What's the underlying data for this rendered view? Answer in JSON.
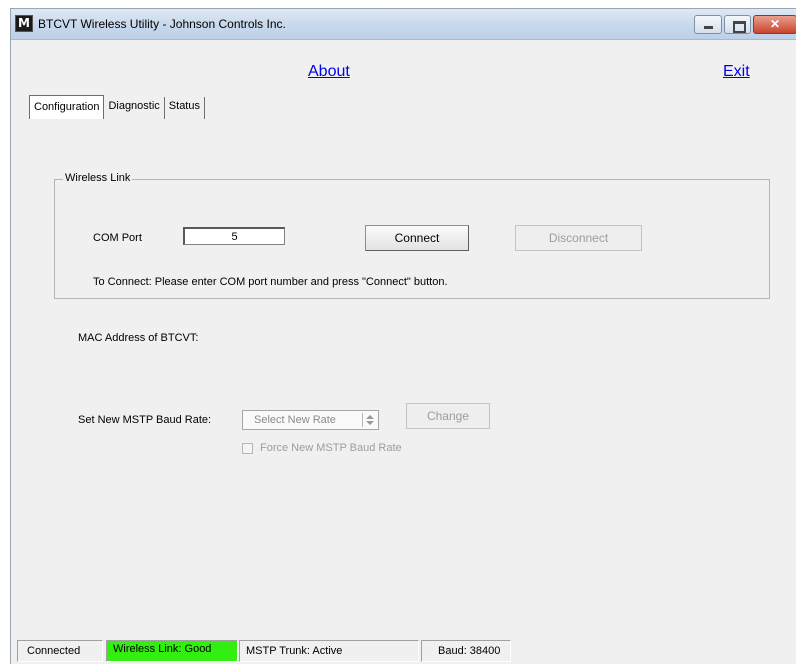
{
  "window": {
    "title": "BTCVT Wireless Utility - Johnson Controls Inc.",
    "icon_letter": "M",
    "controls": {
      "minimize": "minimize-icon",
      "maximize": "maximize-icon",
      "close": "close-icon"
    }
  },
  "header": {
    "about": "About",
    "exit": "Exit"
  },
  "tabs": [
    {
      "label": "Configuration",
      "active": true
    },
    {
      "label": "Diagnostic",
      "active": false
    },
    {
      "label": "Status",
      "active": false
    }
  ],
  "wireless_link": {
    "legend": "Wireless Link",
    "com_port_label": "COM Port",
    "com_port_value": "5",
    "connect_label": "Connect",
    "disconnect_label": "Disconnect",
    "instructions": "To Connect: Please enter COM port number and press \"Connect\" button."
  },
  "mac_address_label": "MAC Address of BTCVT:",
  "baud": {
    "label": "Set New MSTP Baud Rate:",
    "select_value": "Select New Rate",
    "change_label": "Change",
    "force_label": "Force New MSTP Baud Rate",
    "force_checked": false
  },
  "statusbar": {
    "connected": "Connected",
    "wireless": "Wireless Link: Good",
    "wireless_color": "#33ee11",
    "mstp": "MSTP Trunk: Active",
    "baud": "Baud: 38400"
  }
}
